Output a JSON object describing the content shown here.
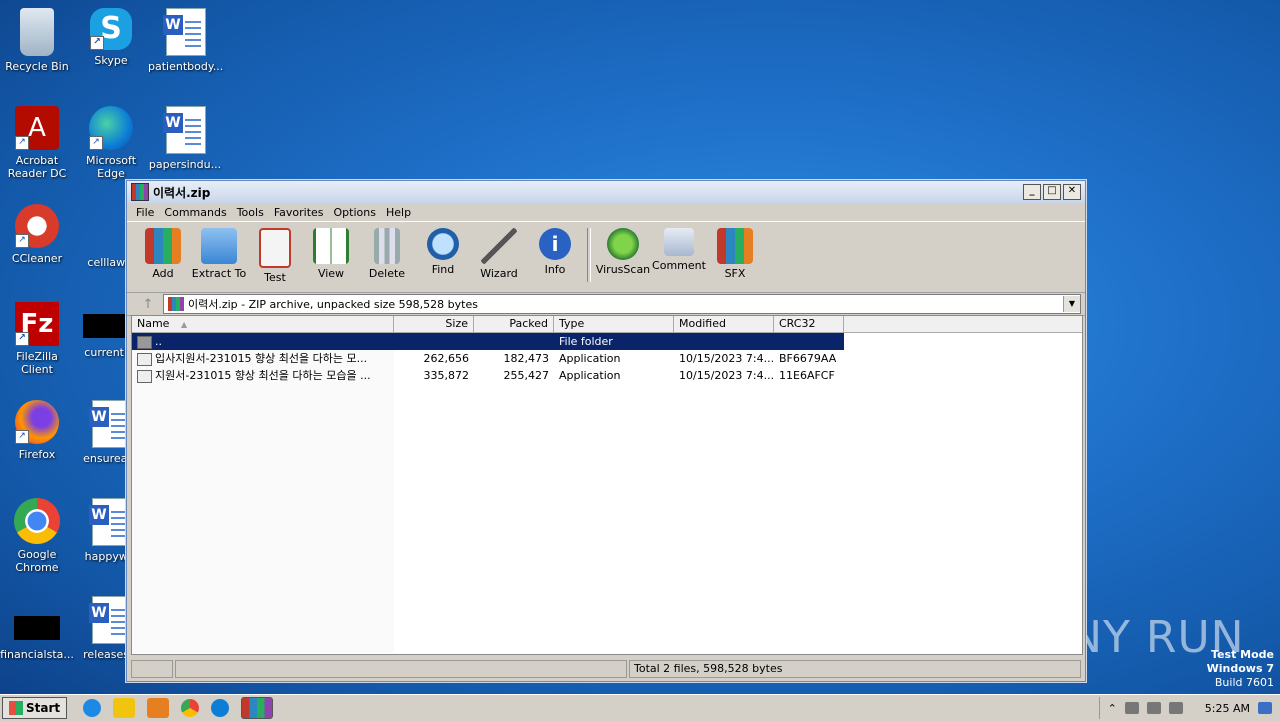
{
  "desktop": {
    "icons": [
      {
        "label": "Recycle Bin"
      },
      {
        "label": "Skype"
      },
      {
        "label": "patientbody..."
      },
      {
        "label": "Acrobat Reader DC"
      },
      {
        "label": "Microsoft Edge"
      },
      {
        "label": "papersindu..."
      },
      {
        "label": "CCleaner"
      },
      {
        "label": "celllaw.p"
      },
      {
        "label": "FileZilla Client"
      },
      {
        "label": "currentba"
      },
      {
        "label": "Firefox"
      },
      {
        "label": "ensureagr"
      },
      {
        "label": "Google Chrome"
      },
      {
        "label": "happyw..."
      },
      {
        "label": "financialsta..."
      },
      {
        "label": "releasesle"
      }
    ],
    "watermark": "ANY RUN",
    "testmode": [
      "Test Mode",
      "Windows 7",
      "Build 7601"
    ]
  },
  "window": {
    "title": "이력서.zip",
    "menu": [
      "File",
      "Commands",
      "Tools",
      "Favorites",
      "Options",
      "Help"
    ],
    "toolbar": [
      "Add",
      "Extract To",
      "Test",
      "View",
      "Delete",
      "Find",
      "Wizard",
      "Info",
      "VirusScan",
      "Comment",
      "SFX"
    ],
    "address": "이력서.zip - ZIP archive, unpacked size 598,528 bytes",
    "columns": {
      "name": "Name",
      "size": "Size",
      "packed": "Packed",
      "type": "Type",
      "modified": "Modified",
      "crc": "CRC32"
    },
    "rows": [
      {
        "name": "..",
        "size": "",
        "packed": "",
        "type": "File folder",
        "modified": "",
        "crc": ""
      },
      {
        "name": "입사지원서-231015 향상 최선을 다하는 모...",
        "size": "262,656",
        "packed": "182,473",
        "type": "Application",
        "modified": "10/15/2023 7:4...",
        "crc": "BF6679AA"
      },
      {
        "name": "지원서-231015 향상 최선을 다하는 모습을 ...",
        "size": "335,872",
        "packed": "255,427",
        "type": "Application",
        "modified": "10/15/2023 7:4...",
        "crc": "11E6AFCF"
      }
    ],
    "status": "Total 2 files, 598,528 bytes"
  },
  "taskbar": {
    "start": "Start",
    "clock": "5:25 AM"
  }
}
